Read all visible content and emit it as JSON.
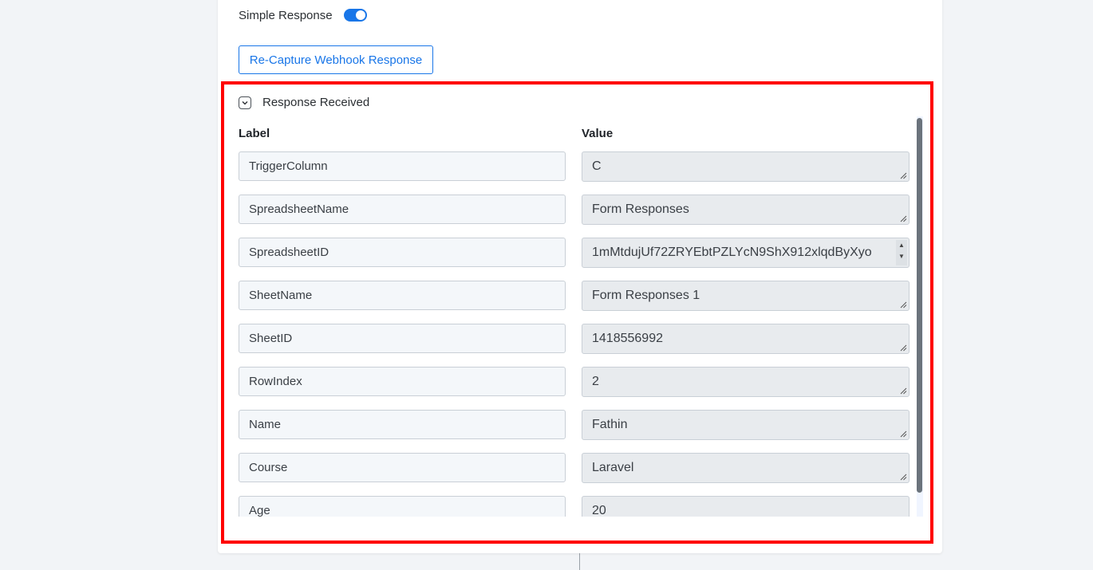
{
  "simple_response": {
    "label": "Simple Response",
    "enabled": true
  },
  "recapture_button": {
    "label": "Re-Capture Webhook Response"
  },
  "response": {
    "title": "Response Received",
    "label_header": "Label",
    "value_header": "Value",
    "rows": [
      {
        "label": "TriggerColumn",
        "value": "C"
      },
      {
        "label": "SpreadsheetName",
        "value": "Form Responses"
      },
      {
        "label": "SpreadsheetID",
        "value": "1mMtdujUf72ZRYEbtPZLYcN9ShX912xlqdByXyo"
      },
      {
        "label": "SheetName",
        "value": "Form Responses 1"
      },
      {
        "label": "SheetID",
        "value": "1418556992"
      },
      {
        "label": "RowIndex",
        "value": "2"
      },
      {
        "label": "Name",
        "value": "Fathin"
      },
      {
        "label": "Course",
        "value": "Laravel"
      },
      {
        "label": "Age",
        "value": "20"
      }
    ]
  },
  "colors": {
    "accent": "#1976e8",
    "highlight": "#ff0000"
  }
}
